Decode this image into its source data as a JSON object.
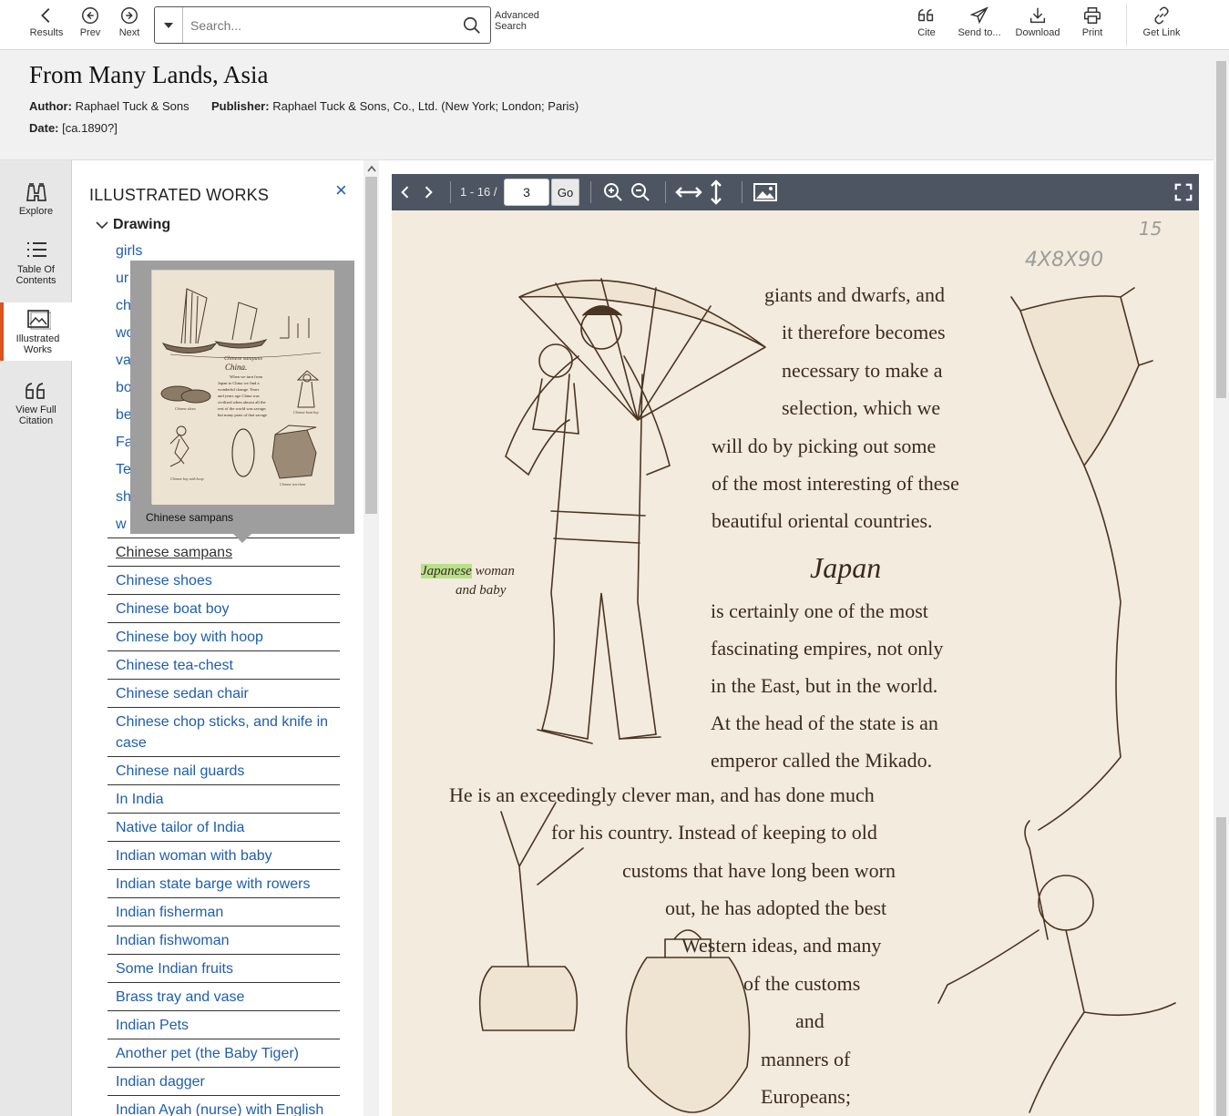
{
  "toolbar": {
    "results_label": "Results",
    "prev_label": "Prev",
    "next_label": "Next",
    "search_placeholder": "Search...",
    "advanced_search_label": "Advanced Search",
    "cite_label": "Cite",
    "send_to_label": "Send to...",
    "download_label": "Download",
    "print_label": "Print",
    "get_link_label": "Get Link"
  },
  "header": {
    "title": "From Many Lands, Asia",
    "author_label": "Author:",
    "author_value": "Raphael Tuck & Sons",
    "publisher_label": "Publisher:",
    "publisher_value": "Raphael Tuck & Sons, Co., Ltd. (New York; London; Paris)",
    "date_label": "Date:",
    "date_value": "[ca.1890?]"
  },
  "rail": {
    "explore": "Explore",
    "toc": "Table Of Contents",
    "illustrated": "Illustrated Works",
    "citation": "View Full Citation"
  },
  "panel": {
    "title": "ILLUSTRATED WORKS",
    "close": "×",
    "group": "Drawing",
    "items": [
      "girls",
      "ur",
      "ch",
      "wo",
      "va",
      "bo",
      "be",
      "Fa",
      "Te",
      "sh",
      "w",
      "Chinese sampans",
      "Chinese shoes",
      "Chinese boat boy",
      "Chinese boy with hoop",
      "Chinese tea-chest",
      "Chinese sedan chair",
      "Chinese chop sticks, and knife in case",
      "Chinese nail guards",
      "In India",
      "Native tailor of India",
      "Indian woman with baby",
      "Indian state barge with rowers",
      "Indian fisherman",
      "Indian fishwoman",
      "Some Indian fruits",
      "Brass tray and vase",
      "Indian Pets",
      "Another pet (the Baby Tiger)",
      "Indian dagger",
      "Indian Ayah (nurse) with English"
    ]
  },
  "tooltip": {
    "caption": "Chinese sampans",
    "thumb_heading": "China.",
    "thumb_label_boats": "Chinese sampans",
    "thumb_label_shoes": "Chinese shoes",
    "thumb_label_boy": "Chinese boat boy",
    "thumb_label_hoop": "Chinese boy with hoop",
    "thumb_label_chest": "Chinese tea-chest",
    "thumb_text_1": "When we turn from",
    "thumb_text_2": "Japan to China we find a",
    "thumb_text_3": "wonderful change. Years",
    "thumb_text_4": "and years ago China was",
    "thumb_text_5": "civilised when almost all the",
    "thumb_text_6": "rest of the world was savage;",
    "thumb_text_7": "but many parts of that savage"
  },
  "viewer": {
    "page_range": "1 - 16 /",
    "page_input": "3",
    "go_label": "Go"
  },
  "page_content": {
    "pencil_top": "15",
    "pencil_num": "4X8X90",
    "caption_hl": "Japanese",
    "caption_rest": "woman",
    "caption_line2": "and baby",
    "heading": "Japan",
    "lines": [
      "giants and dwarfs, and",
      "it therefore becomes",
      "necessary to make a",
      "selection, which we",
      "will do by picking out some",
      "of the most interesting of these",
      "beautiful oriental countries.",
      "is certainly one of the most",
      "fascinating empires, not only",
      "in the East, but in the world.",
      "At the head of the state is an",
      "emperor called the Mikado.",
      "He is an exceedingly clever man, and has done much",
      "for his country. Instead of keeping to old",
      "customs that have long been worn",
      "out, he has adopted the best",
      "Western ideas, and many",
      "of the customs",
      "and",
      "manners of",
      "Europeans;"
    ]
  },
  "colors": {
    "link": "#1f5ea8",
    "accent": "#d9541e",
    "viewer_toolbar": "#4d5563",
    "page_bg": "#f3ebdd",
    "highlight": "#b8e08a"
  }
}
